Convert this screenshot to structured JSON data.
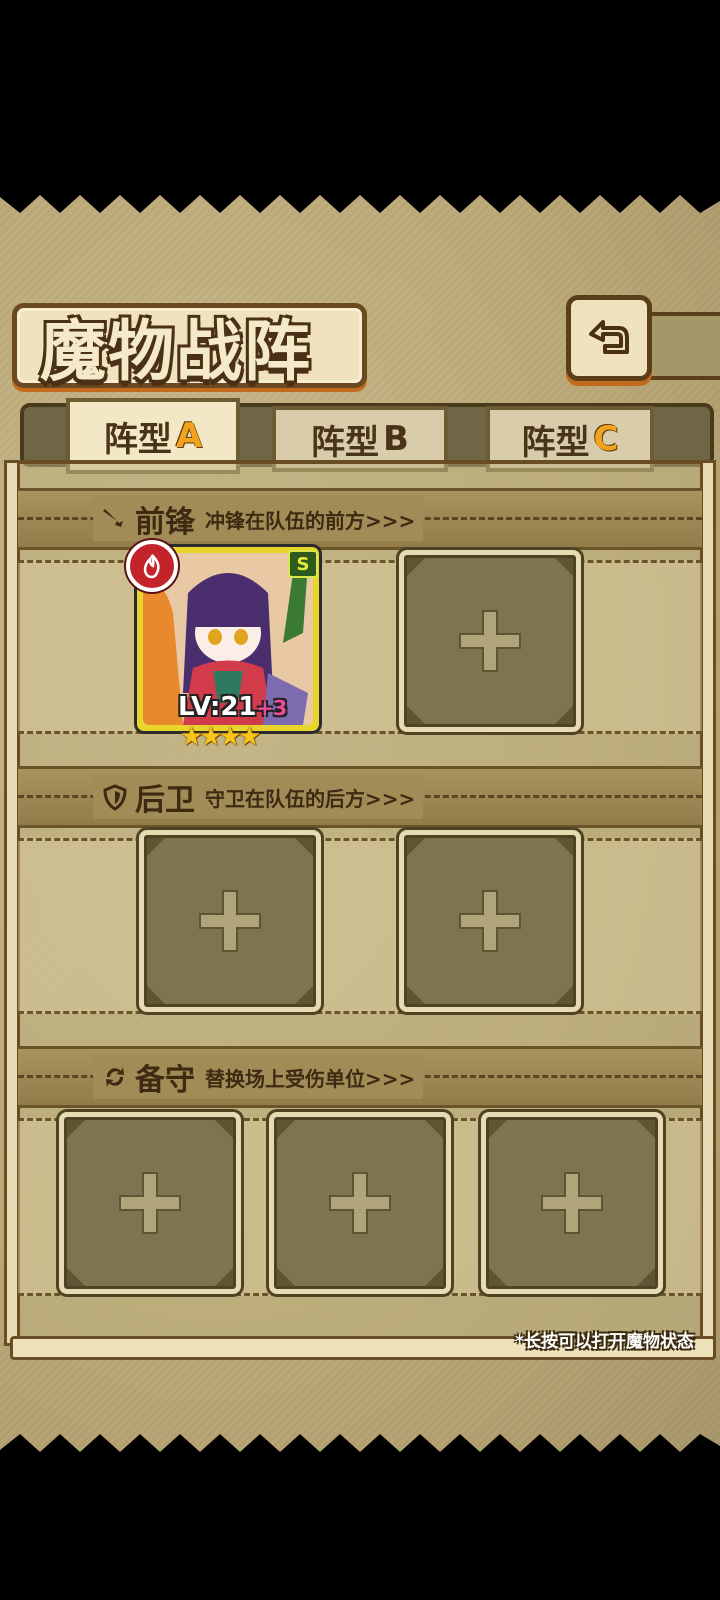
{
  "title": "魔物战阵",
  "back_icon": "return-arrow-icon",
  "tabs": [
    {
      "prefix": "阵型",
      "letter": "A",
      "active": true
    },
    {
      "prefix": "阵型",
      "letter": "B",
      "active": false
    },
    {
      "prefix": "阵型",
      "letter": "C",
      "active": false
    }
  ],
  "sections": {
    "front": {
      "title": "前锋",
      "desc": "冲锋在队伍的前方>>>",
      "icon": "sword-icon"
    },
    "rear": {
      "title": "后卫",
      "desc": "守卫在队伍的后方>>>",
      "icon": "shield-icon"
    },
    "reserve": {
      "title": "备守",
      "desc": "替换场上受伤单位>>>",
      "icon": "swap-icon"
    }
  },
  "monster": {
    "level_label": "LV:21",
    "plus": "+3",
    "rank": "S",
    "stars": 4,
    "element_icon": "fire-icon"
  },
  "empty_slot_icon": "plus-icon",
  "hint": "*长按可以打开魔物状态",
  "colors": {
    "accent": "#f2a21b",
    "fire": "#c4232a",
    "card_border": "#e9d42d"
  }
}
